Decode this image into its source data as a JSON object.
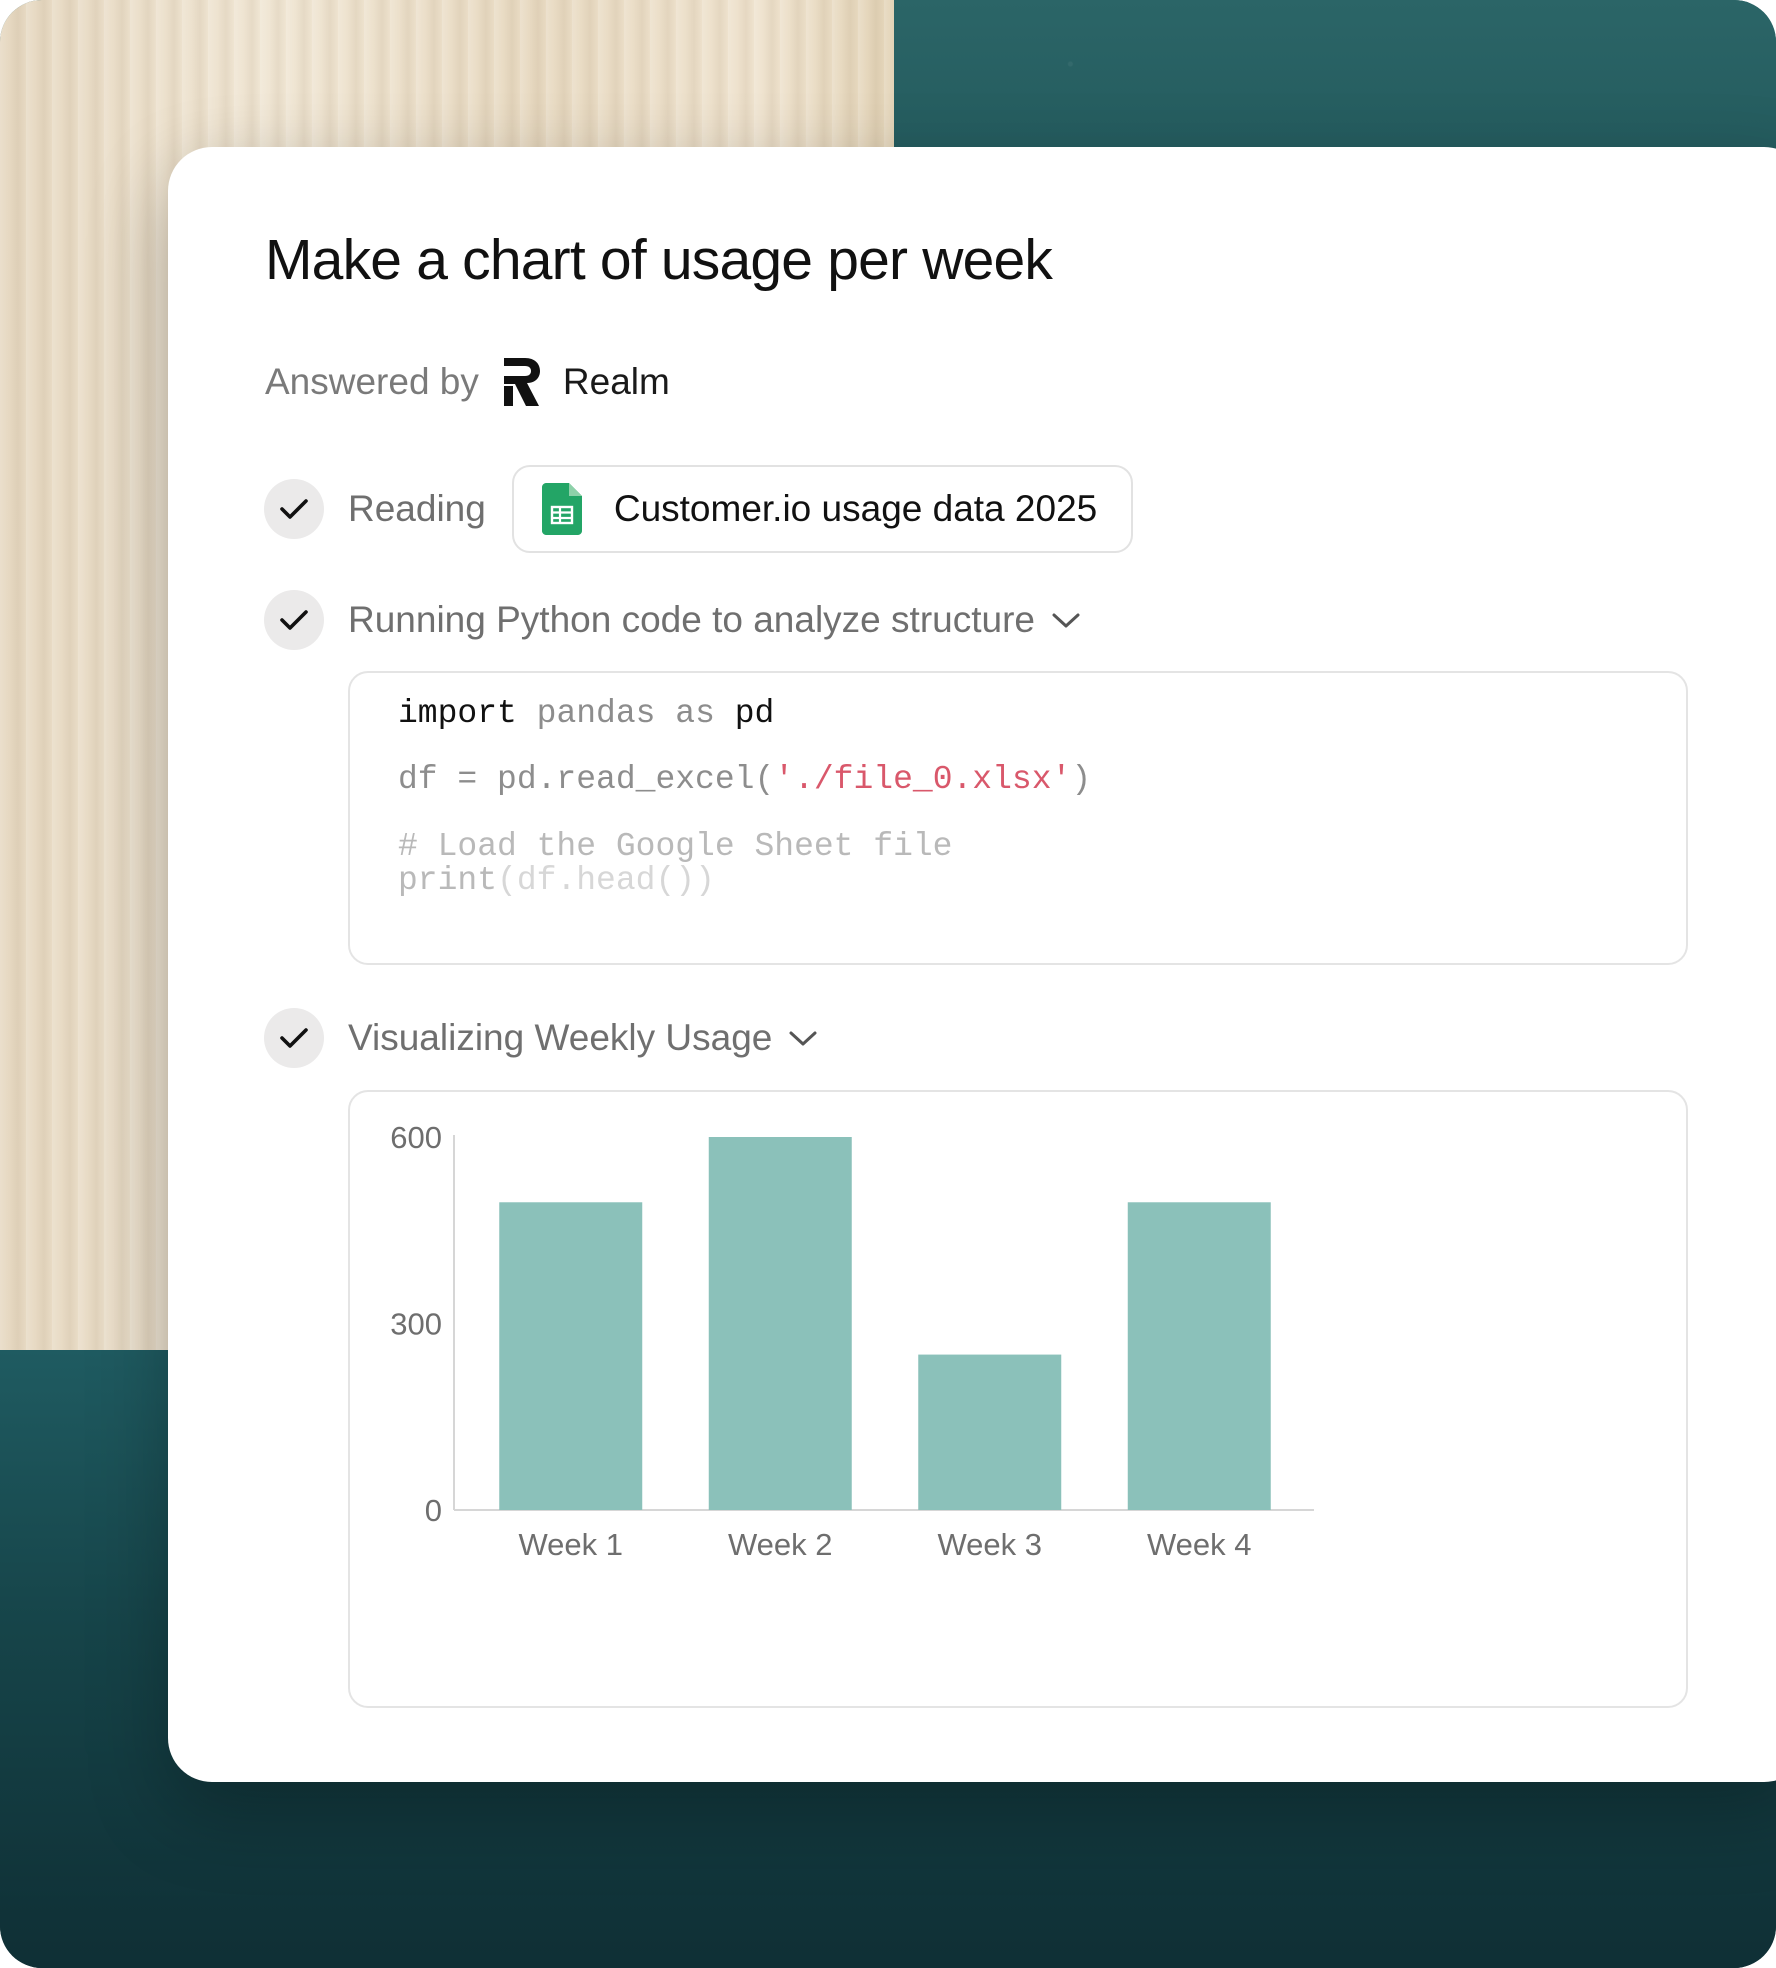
{
  "prompt": {
    "title": "Make a chart of usage per week"
  },
  "answered_by": {
    "label": "Answered by",
    "agent_name": "Realm",
    "logo_icon": "realm-logo-icon"
  },
  "steps": [
    {
      "status": "done",
      "label": "Reading",
      "file": {
        "name": "Customer.io usage data 2025",
        "icon": "google-sheets-icon"
      }
    },
    {
      "status": "done",
      "label": "Running Python code to analyze structure",
      "expandable": true,
      "code": {
        "line1": {
          "kw1": "import",
          "mid1": "pandas",
          "mid2": "as",
          "kw2": "pd"
        },
        "line2": {
          "pre": "df = pd.read_excel(",
          "str": "'./file_0.xlsx'",
          "post": ")"
        },
        "line3": "# Load the Google Sheet file",
        "line4": {
          "fn": "print",
          "args": "(df.head())"
        }
      }
    },
    {
      "status": "done",
      "label": "Visualizing Weekly Usage",
      "expandable": true
    }
  ],
  "colors": {
    "bar": "#8bc1ba",
    "axis": "#d6d6d6",
    "check_bg": "#ebeaea"
  },
  "chart_data": {
    "type": "bar",
    "categories": [
      "Week 1",
      "Week 2",
      "Week 3",
      "Week 4"
    ],
    "values": [
      495,
      600,
      250,
      495
    ],
    "ylim": [
      0,
      600
    ],
    "yticks": [
      "0",
      "300",
      "600"
    ],
    "ytick_values": [
      0,
      300,
      600
    ],
    "title": "",
    "xlabel": "",
    "ylabel": "",
    "grid": false
  }
}
